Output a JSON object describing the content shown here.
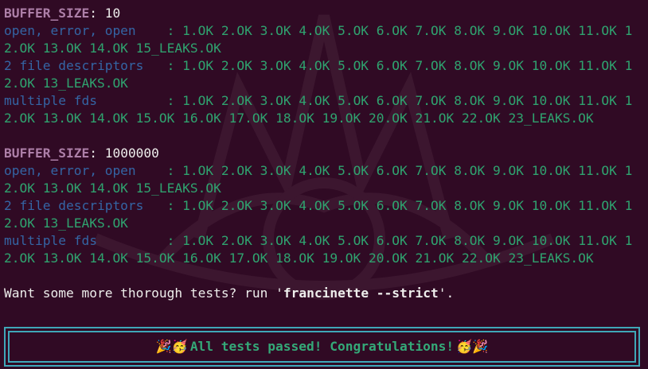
{
  "sections": [
    {
      "buffer_label": "BUFFER_SIZE",
      "buffer_sep": ":",
      "buffer_value": "10",
      "tests": [
        {
          "name": "open, error, open   ",
          "line1": " : 1.OK 2.OK 3.OK 4.OK 5.OK 6.OK 7.OK 8.OK 9.OK 10.OK 11.OK 1",
          "line2": "2.OK 13.OK 14.OK 15_LEAKS.OK"
        },
        {
          "name": "2 file descriptors  ",
          "line1": " : 1.OK 2.OK 3.OK 4.OK 5.OK 6.OK 7.OK 8.OK 9.OK 10.OK 11.OK 1",
          "line2": "2.OK 13_LEAKS.OK"
        },
        {
          "name": "multiple fds        ",
          "line1": " : 1.OK 2.OK 3.OK 4.OK 5.OK 6.OK 7.OK 8.OK 9.OK 10.OK 11.OK 1",
          "line2": "2.OK 13.OK 14.OK 15.OK 16.OK 17.OK 18.OK 19.OK 20.OK 21.OK 22.OK 23_LEAKS.OK"
        }
      ]
    },
    {
      "buffer_label": "BUFFER_SIZE",
      "buffer_sep": ":",
      "buffer_value": "1000000",
      "tests": [
        {
          "name": "open, error, open   ",
          "line1": " : 1.OK 2.OK 3.OK 4.OK 5.OK 6.OK 7.OK 8.OK 9.OK 10.OK 11.OK 1",
          "line2": "2.OK 13.OK 14.OK 15_LEAKS.OK"
        },
        {
          "name": "2 file descriptors  ",
          "line1": " : 1.OK 2.OK 3.OK 4.OK 5.OK 6.OK 7.OK 8.OK 9.OK 10.OK 11.OK 1",
          "line2": "2.OK 13_LEAKS.OK"
        },
        {
          "name": "multiple fds        ",
          "line1": " : 1.OK 2.OK 3.OK 4.OK 5.OK 6.OK 7.OK 8.OK 9.OK 10.OK 11.OK 1",
          "line2": "2.OK 13.OK 14.OK 15.OK 16.OK 17.OK 18.OK 19.OK 20.OK 21.OK 22.OK 23_LEAKS.OK"
        }
      ]
    }
  ],
  "hint": {
    "prefix": "Want some more thorough tests? run '",
    "command": "francinette --strict",
    "suffix": "'."
  },
  "banner": {
    "emoji_left": "🎉🥳",
    "text": "All tests passed! Congratulations!",
    "emoji_right": "🥳🎉"
  },
  "colors": {
    "background": "#300a24",
    "buffer_label": "#ad7fa8",
    "test_name": "#3465a4",
    "ok": "#2fa36f",
    "banner_border": "#3fa7b8"
  },
  "icons": [
    "party-popper-icon",
    "partying-face-icon",
    "francinette-logo-watermark"
  ]
}
